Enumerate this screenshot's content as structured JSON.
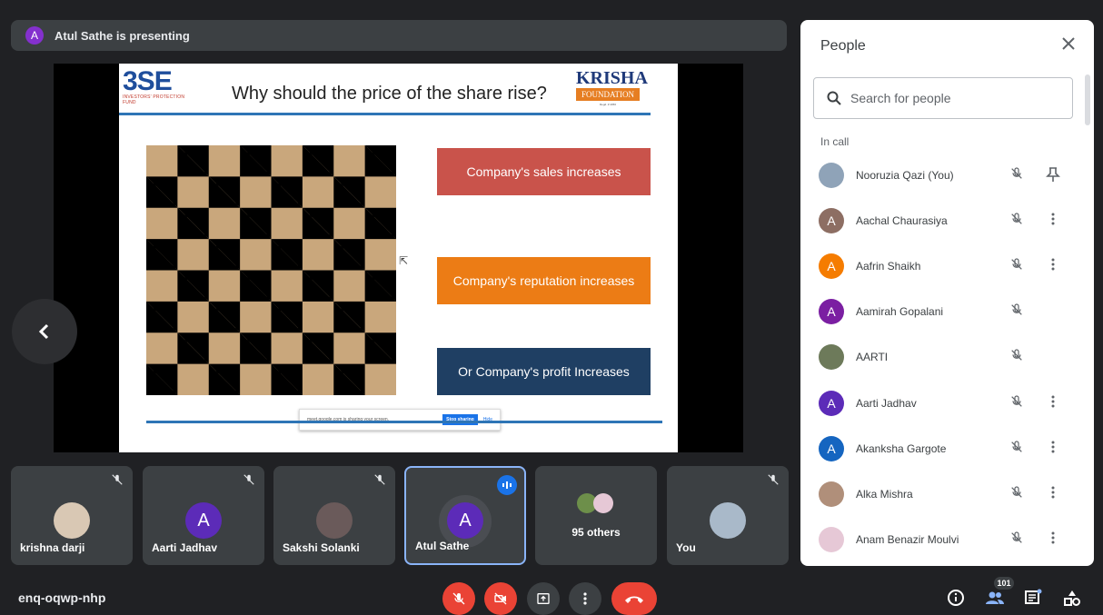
{
  "presenting": {
    "avatar_letter": "A",
    "text": "Atul Sathe is presenting"
  },
  "slide": {
    "bse_logo_text": "3SE",
    "bse_subtext": "INVESTORS' PROTECTION FUND",
    "title": "Why should the price of the share rise?",
    "krisha_line1": "KRISHA",
    "krisha_line2": "FOUNDATION",
    "krisha_line3": "Regd. # 4056",
    "boxes": [
      "Company's sales increases",
      "Company's reputation increases",
      "Or Company's profit Increases"
    ],
    "box_colors": [
      "#c9534b",
      "#ec7c15",
      "#1f3f63"
    ],
    "share_bar": {
      "message": "meet.google.com is sharing your screen.",
      "stop": "Stop sharing",
      "hide": "Hide"
    }
  },
  "tiles": [
    {
      "name": "krishna darji",
      "muted": true
    },
    {
      "name": "Aarti Jadhav",
      "avatar_letter": "A",
      "muted": true
    },
    {
      "name": "Sakshi Solanki",
      "muted": true
    },
    {
      "name": "Atul Sathe",
      "avatar_letter": "A",
      "speaking": true
    },
    {
      "label": "95 others"
    },
    {
      "name": "You",
      "muted": true
    }
  ],
  "people_panel": {
    "title": "People",
    "search_placeholder": "Search for people",
    "section": "In call",
    "people": [
      {
        "name": "Nooruzia Qazi (You)",
        "avatar": "photo",
        "color": "#8fa3b8",
        "action": "pin-icon"
      },
      {
        "name": "Aachal Chaurasiya",
        "avatar": "A",
        "color": "#8d6e63",
        "action": "more-vert-icon"
      },
      {
        "name": "Aafrin Shaikh",
        "avatar": "A",
        "color": "#f57c00",
        "action": "more-vert-icon"
      },
      {
        "name": "Aamirah Gopalani",
        "avatar": "A",
        "color": "#7b1fa2",
        "action": ""
      },
      {
        "name": "AARTI",
        "avatar": "photo",
        "color": "#6d7a5a",
        "action": ""
      },
      {
        "name": "Aarti Jadhav",
        "avatar": "A",
        "color": "#5c2bb8",
        "action": "more-vert-icon"
      },
      {
        "name": "Akanksha Gargote",
        "avatar": "A",
        "color": "#1565c0",
        "action": "more-vert-icon"
      },
      {
        "name": "Alka Mishra",
        "avatar": "photo",
        "color": "#b08f7a",
        "action": "more-vert-icon"
      },
      {
        "name": "Anam Benazir Moulvi",
        "avatar": "photo",
        "color": "#e6c8d6",
        "action": "more-vert-icon"
      }
    ]
  },
  "bottom_bar": {
    "meeting_code": "enq-oqwp-nhp",
    "participant_count": "101"
  },
  "colors": {
    "accent": "#1a73e8",
    "danger": "#ea4335",
    "tile_bg": "#3c4043",
    "app_bg": "#202124"
  }
}
